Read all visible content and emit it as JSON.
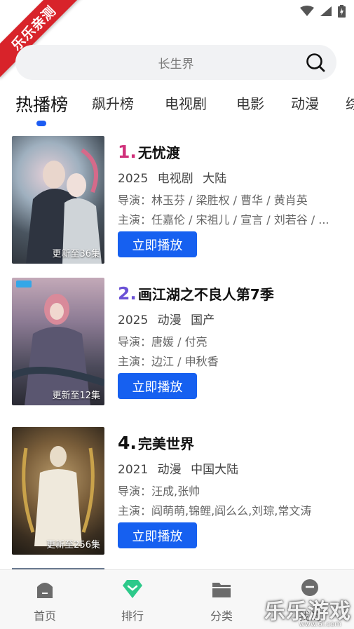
{
  "status_bar": {
    "ribbon_text": "乐乐亲测",
    "icons": [
      "wifi-icon",
      "signal-icon",
      "battery-icon"
    ]
  },
  "search": {
    "placeholder": "长生界"
  },
  "tabs": [
    {
      "label": "热播榜",
      "active": true
    },
    {
      "label": "飙升榜",
      "active": false
    },
    {
      "label": "电视剧",
      "active": false
    },
    {
      "label": "电影",
      "active": false
    },
    {
      "label": "动漫",
      "active": false
    },
    {
      "label": "综",
      "active": false
    }
  ],
  "items": [
    {
      "rank": "1.",
      "title": "无忧渡",
      "year": "2025",
      "type": "电视剧",
      "region": "大陆",
      "director": "导演：林玉芬 / 梁胜权 / 曹华 / 黄肖英",
      "actors": "主演：任嘉伦 / 宋祖儿 / 宣言 / 刘若谷 / ...",
      "badge": "更新至36集",
      "button": "立即播放",
      "rank_color": "#d0307a"
    },
    {
      "rank": "2.",
      "title": "画江湖之不良人第7季",
      "year": "2025",
      "type": "动漫",
      "region": "国产",
      "director": "导演：唐媛 / 付亮",
      "actors": "主演：边江 / 申秋香",
      "badge": "更新至12集",
      "button": "立即播放",
      "rank_color": "#6b52d6"
    },
    {
      "rank": "4.",
      "title": "完美世界",
      "year": "2021",
      "type": "动漫",
      "region": "中国大陆",
      "director": "导演：汪成,张帅",
      "actors": "主演：阎萌萌,锦鲤,阎么么,刘琮,常文涛",
      "badge": "更新至256集",
      "button": "立即播放",
      "rank_color": "#111111"
    }
  ],
  "bottom_nav": [
    {
      "label": "首页",
      "icon": "home-icon",
      "active": false
    },
    {
      "label": "排行",
      "icon": "ranking-icon",
      "active": true
    },
    {
      "label": "分类",
      "icon": "folder-icon",
      "active": false
    },
    {
      "label": "我的",
      "icon": "profile-icon",
      "active": false
    }
  ],
  "watermark": {
    "text": "乐乐游戏",
    "sub": "www.6l.com"
  },
  "colors": {
    "accent": "#1d5cf2",
    "button": "#1660f0",
    "ribbon": "#d8232a",
    "nav_active_icon": "#2dc98a"
  }
}
